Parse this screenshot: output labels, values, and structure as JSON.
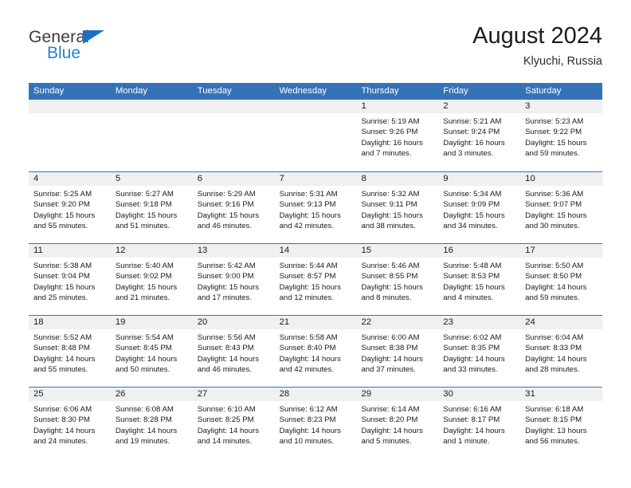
{
  "brand": {
    "name_part1": "General",
    "name_part2": "Blue",
    "primary_color": "#1f6fc4",
    "accent_color": "#1f84d6"
  },
  "header": {
    "title": "August 2024",
    "location": "Klyuchi, Russia"
  },
  "calendar": {
    "header_bg": "#3573b9",
    "band_bg": "#f0f0f0",
    "weekdays": [
      "Sunday",
      "Monday",
      "Tuesday",
      "Wednesday",
      "Thursday",
      "Friday",
      "Saturday"
    ],
    "weeks": [
      {
        "shaded": true,
        "days": [
          {
            "num": "",
            "empty": true,
            "sunrise": "",
            "sunset": "",
            "daylight_line1": "",
            "daylight_line2": ""
          },
          {
            "num": "",
            "empty": true,
            "sunrise": "",
            "sunset": "",
            "daylight_line1": "",
            "daylight_line2": ""
          },
          {
            "num": "",
            "empty": true,
            "sunrise": "",
            "sunset": "",
            "daylight_line1": "",
            "daylight_line2": ""
          },
          {
            "num": "",
            "empty": true,
            "sunrise": "",
            "sunset": "",
            "daylight_line1": "",
            "daylight_line2": ""
          },
          {
            "num": "1",
            "empty": false,
            "sunrise": "Sunrise: 5:19 AM",
            "sunset": "Sunset: 9:26 PM",
            "daylight_line1": "Daylight: 16 hours",
            "daylight_line2": "and 7 minutes."
          },
          {
            "num": "2",
            "empty": false,
            "sunrise": "Sunrise: 5:21 AM",
            "sunset": "Sunset: 9:24 PM",
            "daylight_line1": "Daylight: 16 hours",
            "daylight_line2": "and 3 minutes."
          },
          {
            "num": "3",
            "empty": false,
            "sunrise": "Sunrise: 5:23 AM",
            "sunset": "Sunset: 9:22 PM",
            "daylight_line1": "Daylight: 15 hours",
            "daylight_line2": "and 59 minutes."
          }
        ]
      },
      {
        "shaded": true,
        "days": [
          {
            "num": "4",
            "empty": false,
            "sunrise": "Sunrise: 5:25 AM",
            "sunset": "Sunset: 9:20 PM",
            "daylight_line1": "Daylight: 15 hours",
            "daylight_line2": "and 55 minutes."
          },
          {
            "num": "5",
            "empty": false,
            "sunrise": "Sunrise: 5:27 AM",
            "sunset": "Sunset: 9:18 PM",
            "daylight_line1": "Daylight: 15 hours",
            "daylight_line2": "and 51 minutes."
          },
          {
            "num": "6",
            "empty": false,
            "sunrise": "Sunrise: 5:29 AM",
            "sunset": "Sunset: 9:16 PM",
            "daylight_line1": "Daylight: 15 hours",
            "daylight_line2": "and 46 minutes."
          },
          {
            "num": "7",
            "empty": false,
            "sunrise": "Sunrise: 5:31 AM",
            "sunset": "Sunset: 9:13 PM",
            "daylight_line1": "Daylight: 15 hours",
            "daylight_line2": "and 42 minutes."
          },
          {
            "num": "8",
            "empty": false,
            "sunrise": "Sunrise: 5:32 AM",
            "sunset": "Sunset: 9:11 PM",
            "daylight_line1": "Daylight: 15 hours",
            "daylight_line2": "and 38 minutes."
          },
          {
            "num": "9",
            "empty": false,
            "sunrise": "Sunrise: 5:34 AM",
            "sunset": "Sunset: 9:09 PM",
            "daylight_line1": "Daylight: 15 hours",
            "daylight_line2": "and 34 minutes."
          },
          {
            "num": "10",
            "empty": false,
            "sunrise": "Sunrise: 5:36 AM",
            "sunset": "Sunset: 9:07 PM",
            "daylight_line1": "Daylight: 15 hours",
            "daylight_line2": "and 30 minutes."
          }
        ]
      },
      {
        "shaded": true,
        "days": [
          {
            "num": "11",
            "empty": false,
            "sunrise": "Sunrise: 5:38 AM",
            "sunset": "Sunset: 9:04 PM",
            "daylight_line1": "Daylight: 15 hours",
            "daylight_line2": "and 25 minutes."
          },
          {
            "num": "12",
            "empty": false,
            "sunrise": "Sunrise: 5:40 AM",
            "sunset": "Sunset: 9:02 PM",
            "daylight_line1": "Daylight: 15 hours",
            "daylight_line2": "and 21 minutes."
          },
          {
            "num": "13",
            "empty": false,
            "sunrise": "Sunrise: 5:42 AM",
            "sunset": "Sunset: 9:00 PM",
            "daylight_line1": "Daylight: 15 hours",
            "daylight_line2": "and 17 minutes."
          },
          {
            "num": "14",
            "empty": false,
            "sunrise": "Sunrise: 5:44 AM",
            "sunset": "Sunset: 8:57 PM",
            "daylight_line1": "Daylight: 15 hours",
            "daylight_line2": "and 12 minutes."
          },
          {
            "num": "15",
            "empty": false,
            "sunrise": "Sunrise: 5:46 AM",
            "sunset": "Sunset: 8:55 PM",
            "daylight_line1": "Daylight: 15 hours",
            "daylight_line2": "and 8 minutes."
          },
          {
            "num": "16",
            "empty": false,
            "sunrise": "Sunrise: 5:48 AM",
            "sunset": "Sunset: 8:53 PM",
            "daylight_line1": "Daylight: 15 hours",
            "daylight_line2": "and 4 minutes."
          },
          {
            "num": "17",
            "empty": false,
            "sunrise": "Sunrise: 5:50 AM",
            "sunset": "Sunset: 8:50 PM",
            "daylight_line1": "Daylight: 14 hours",
            "daylight_line2": "and 59 minutes."
          }
        ]
      },
      {
        "shaded": true,
        "days": [
          {
            "num": "18",
            "empty": false,
            "sunrise": "Sunrise: 5:52 AM",
            "sunset": "Sunset: 8:48 PM",
            "daylight_line1": "Daylight: 14 hours",
            "daylight_line2": "and 55 minutes."
          },
          {
            "num": "19",
            "empty": false,
            "sunrise": "Sunrise: 5:54 AM",
            "sunset": "Sunset: 8:45 PM",
            "daylight_line1": "Daylight: 14 hours",
            "daylight_line2": "and 50 minutes."
          },
          {
            "num": "20",
            "empty": false,
            "sunrise": "Sunrise: 5:56 AM",
            "sunset": "Sunset: 8:43 PM",
            "daylight_line1": "Daylight: 14 hours",
            "daylight_line2": "and 46 minutes."
          },
          {
            "num": "21",
            "empty": false,
            "sunrise": "Sunrise: 5:58 AM",
            "sunset": "Sunset: 8:40 PM",
            "daylight_line1": "Daylight: 14 hours",
            "daylight_line2": "and 42 minutes."
          },
          {
            "num": "22",
            "empty": false,
            "sunrise": "Sunrise: 6:00 AM",
            "sunset": "Sunset: 8:38 PM",
            "daylight_line1": "Daylight: 14 hours",
            "daylight_line2": "and 37 minutes."
          },
          {
            "num": "23",
            "empty": false,
            "sunrise": "Sunrise: 6:02 AM",
            "sunset": "Sunset: 8:35 PM",
            "daylight_line1": "Daylight: 14 hours",
            "daylight_line2": "and 33 minutes."
          },
          {
            "num": "24",
            "empty": false,
            "sunrise": "Sunrise: 6:04 AM",
            "sunset": "Sunset: 8:33 PM",
            "daylight_line1": "Daylight: 14 hours",
            "daylight_line2": "and 28 minutes."
          }
        ]
      },
      {
        "shaded": true,
        "days": [
          {
            "num": "25",
            "empty": false,
            "sunrise": "Sunrise: 6:06 AM",
            "sunset": "Sunset: 8:30 PM",
            "daylight_line1": "Daylight: 14 hours",
            "daylight_line2": "and 24 minutes."
          },
          {
            "num": "26",
            "empty": false,
            "sunrise": "Sunrise: 6:08 AM",
            "sunset": "Sunset: 8:28 PM",
            "daylight_line1": "Daylight: 14 hours",
            "daylight_line2": "and 19 minutes."
          },
          {
            "num": "27",
            "empty": false,
            "sunrise": "Sunrise: 6:10 AM",
            "sunset": "Sunset: 8:25 PM",
            "daylight_line1": "Daylight: 14 hours",
            "daylight_line2": "and 14 minutes."
          },
          {
            "num": "28",
            "empty": false,
            "sunrise": "Sunrise: 6:12 AM",
            "sunset": "Sunset: 8:23 PM",
            "daylight_line1": "Daylight: 14 hours",
            "daylight_line2": "and 10 minutes."
          },
          {
            "num": "29",
            "empty": false,
            "sunrise": "Sunrise: 6:14 AM",
            "sunset": "Sunset: 8:20 PM",
            "daylight_line1": "Daylight: 14 hours",
            "daylight_line2": "and 5 minutes."
          },
          {
            "num": "30",
            "empty": false,
            "sunrise": "Sunrise: 6:16 AM",
            "sunset": "Sunset: 8:17 PM",
            "daylight_line1": "Daylight: 14 hours",
            "daylight_line2": "and 1 minute."
          },
          {
            "num": "31",
            "empty": false,
            "sunrise": "Sunrise: 6:18 AM",
            "sunset": "Sunset: 8:15 PM",
            "daylight_line1": "Daylight: 13 hours",
            "daylight_line2": "and 56 minutes."
          }
        ]
      }
    ]
  }
}
